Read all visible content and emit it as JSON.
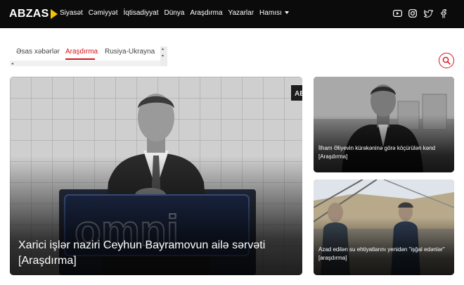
{
  "brand": {
    "name": "ABZAS"
  },
  "nav": {
    "items": [
      "Siyasət",
      "Cəmiyyət",
      "İqtisadiyyat",
      "Dünya",
      "Araşdırma",
      "Yazarlar"
    ],
    "more_label": "Hamısı"
  },
  "social": [
    "youtube-icon",
    "instagram-icon",
    "twitter-icon",
    "facebook-icon"
  ],
  "tabs": {
    "items": [
      "Əsas xəbərlər",
      "Araşdırma",
      "Rusiya-Ukrayna"
    ],
    "active_index": 1
  },
  "colors": {
    "accent": "#d6121a",
    "brand_yellow": "#f5c400",
    "topbar": "#0b0b0b"
  },
  "featured": {
    "title": "Xarici işlər naziri Ceyhun Bayramovun ailə sərvəti [Araşdırma]",
    "image_sign_text": "omni",
    "image_corner_text": "AE"
  },
  "side_articles": [
    {
      "title": "İlham Əliyevin kürəkəninə görə köçürülən kənd [Araşdırma]"
    },
    {
      "title": "Azad edilən su ehtiyatlarını yenidən \"işğal edənlər\" [araşdırma]"
    }
  ]
}
